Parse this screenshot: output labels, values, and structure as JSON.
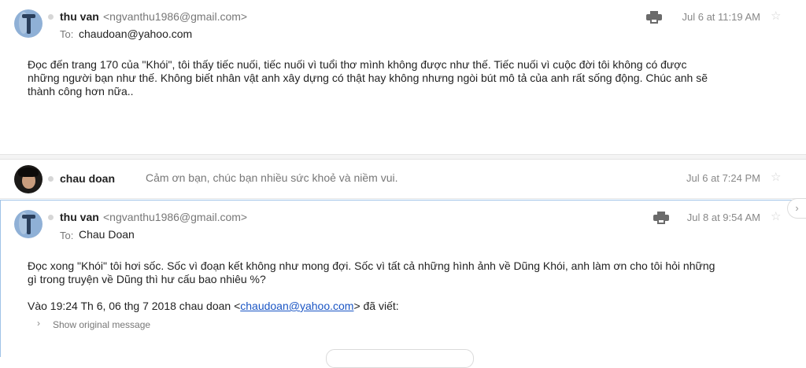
{
  "messages": [
    {
      "sender_name": "thu van",
      "sender_email": "<ngvanthu1986@gmail.com>",
      "to_label": "To:",
      "to_value": "chaudoan@yahoo.com",
      "date": "Jul 6 at 11:19 AM",
      "body_lines": [
        "Đọc đến trang 170 của \"Khói\",  tôi thấy tiếc nuối, tiếc nuối vì tuổi thơ mình không được như thế.   Tiếc nuối vì cuộc đời tôi không có được",
        "những người bạn như thế. Không biết nhân vật anh xây dựng có thật hay không nhưng  ngòi bút mô tả của anh rất sống động. Chúc anh sẽ",
        "thành công hơn nữa.."
      ]
    },
    {
      "sender_name": "chau doan",
      "snippet": "Cảm ơn bạn, chúc bạn nhiều sức khoẻ và niềm vui.",
      "date": "Jul 6 at 7:24 PM"
    },
    {
      "sender_name": "thu van",
      "sender_email": "<ngvanthu1986@gmail.com>",
      "to_label": "To:",
      "to_value": "Chau Doan",
      "date": "Jul 8 at 9:54 AM",
      "body_lines": [
        "Đọc xong \"Khói\" tôi hơi sốc.  Sốc vì đoạn kết không như mong đợi.  Sốc vì tất cả những hình ảnh về Dũng Khói,  anh làm ơn cho tôi hỏi những",
        "gì trong truyện về Dũng thì hư cấu bao nhiêu %?"
      ],
      "quote_prefix": "Vào 19:24 Th 6, 06 thg 7 2018 chau doan <",
      "quote_email": "chaudoan@yahoo.com",
      "quote_suffix": "> đã viết:",
      "show_original": "Show original message"
    }
  ],
  "icons": {
    "star": "☆",
    "printer": "printer-icon",
    "chevron_right": "›"
  },
  "colors": {
    "link": "#1a55c4",
    "selected_border": "#9fc3e7",
    "muted": "#777777"
  }
}
